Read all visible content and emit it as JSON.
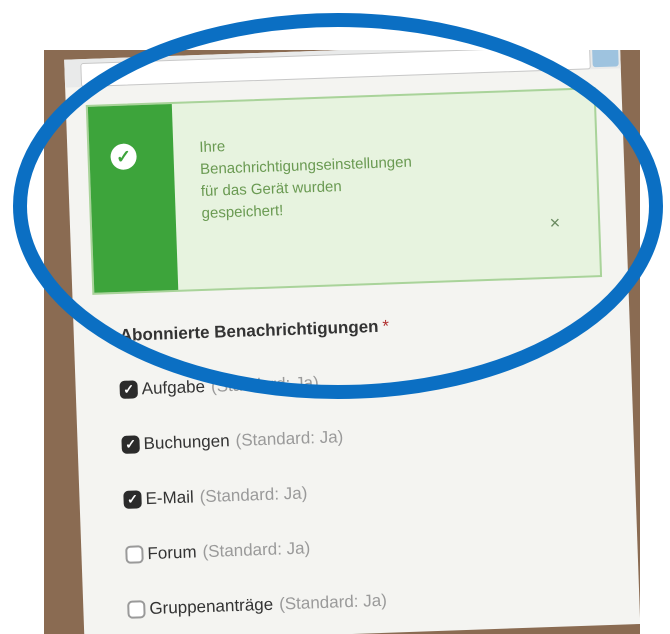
{
  "alert": {
    "message": "Ihre Benachrichtigungseinstellungen für das Gerät wurden gespeichert!",
    "close_symbol": "×",
    "icon": "check-circle-icon",
    "accent_color": "#3da43b"
  },
  "subscriptions": {
    "title": "Abonnierte Benachrichtigungen",
    "required_marker": "*",
    "options": [
      {
        "label": "Aufgabe",
        "default_text": "(Standard: Ja)",
        "checked": true
      },
      {
        "label": "Buchungen",
        "default_text": "(Standard: Ja)",
        "checked": true
      },
      {
        "label": "E-Mail",
        "default_text": "(Standard: Ja)",
        "checked": true
      },
      {
        "label": "Forum",
        "default_text": "(Standard: Ja)",
        "checked": false
      },
      {
        "label": "Gruppenanträge",
        "default_text": "(Standard: Ja)",
        "checked": false
      }
    ]
  },
  "annotation": {
    "shape": "ellipse",
    "color": "#0b6fc3"
  }
}
